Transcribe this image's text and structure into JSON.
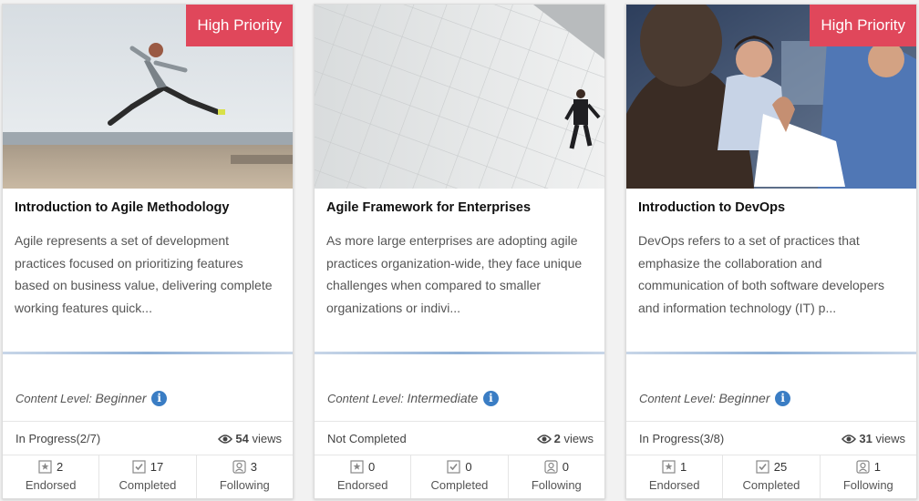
{
  "cards": [
    {
      "badge": "High Priority",
      "title": "Introduction to Agile Methodology",
      "description": "Agile represents a set of development practices focused on prioritizing features based on business value, delivering complete working features quick...",
      "level_label": "Content Level:",
      "level_value": "Beginner",
      "status": "In Progress(2/7)",
      "views_count": "54",
      "views_label": "views",
      "endorsed": "2",
      "completed": "17",
      "following": "3",
      "endorsed_label": "Endorsed",
      "completed_label": "Completed",
      "following_label": "Following"
    },
    {
      "badge": "",
      "title": "Agile Framework for Enterprises",
      "description": "As more large enterprises are adopting agile practices organization-wide, they face unique challenges when compared to smaller organizations or indivi...",
      "level_label": "Content Level:",
      "level_value": "Intermediate",
      "status": "Not Completed",
      "views_count": "2",
      "views_label": "views",
      "endorsed": "0",
      "completed": "0",
      "following": "0",
      "endorsed_label": "Endorsed",
      "completed_label": "Completed",
      "following_label": "Following"
    },
    {
      "badge": "High Priority",
      "title": "Introduction to DevOps",
      "description": "DevOps refers to a set of practices that emphasize the collaboration and communication of both software developers and information technology (IT) p...",
      "level_label": "Content Level:",
      "level_value": "Beginner",
      "status": "In Progress(3/8)",
      "views_count": "31",
      "views_label": "views",
      "endorsed": "1",
      "completed": "25",
      "following": "1",
      "endorsed_label": "Endorsed",
      "completed_label": "Completed",
      "following_label": "Following"
    }
  ],
  "colors": {
    "badge": "#e0475b",
    "info": "#3a7dc4"
  },
  "icons": [
    "info-icon",
    "eye-icon",
    "endorsed-icon",
    "completed-icon",
    "following-icon"
  ]
}
